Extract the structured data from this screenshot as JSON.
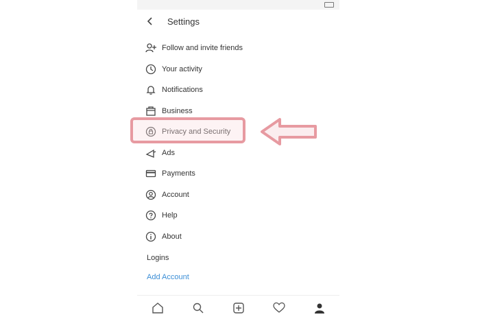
{
  "status_bar": {
    "left": "",
    "right": ""
  },
  "header": {
    "title": "Settings",
    "back_icon": "back-arrow-icon"
  },
  "menu": {
    "items": [
      {
        "label": "Follow and invite friends",
        "icon": "person-add-icon"
      },
      {
        "label": "Your activity",
        "icon": "activity-icon"
      },
      {
        "label": "Notifications",
        "icon": "bell-icon"
      },
      {
        "label": "Business",
        "icon": "business-icon"
      },
      {
        "label": "Privacy and Security",
        "icon": "lock-icon"
      },
      {
        "label": "Ads",
        "icon": "megaphone-icon"
      },
      {
        "label": "Payments",
        "icon": "card-icon"
      },
      {
        "label": "Account",
        "icon": "account-icon"
      },
      {
        "label": "Help",
        "icon": "help-icon"
      },
      {
        "label": "About",
        "icon": "info-icon"
      }
    ]
  },
  "logins": {
    "label": "Logins",
    "link": "Add Account"
  },
  "bottom_nav": [
    "home-icon",
    "search-icon",
    "add-post-icon",
    "heart-icon",
    "profile-icon"
  ],
  "annotation": {
    "highlight_color": "#e79aa1"
  }
}
